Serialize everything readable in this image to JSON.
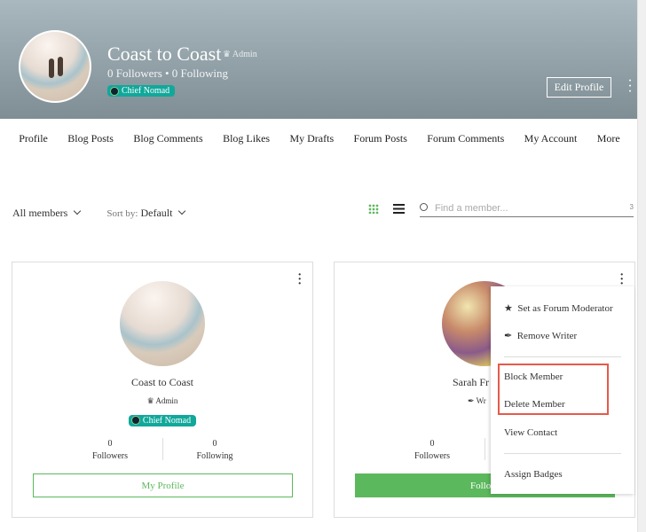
{
  "profile": {
    "name": "Coast to Coast",
    "role": "Admin",
    "stats": "0 Followers • 0 Following",
    "badge": "Chief Nomad",
    "edit_label": "Edit Profile"
  },
  "nav": [
    "Profile",
    "Blog Posts",
    "Blog Comments",
    "Blog Likes",
    "My Drafts",
    "Forum Posts",
    "Forum Comments",
    "My Account",
    "More"
  ],
  "filters": {
    "members": "All members",
    "sort_label": "Sort by:",
    "sort_value": "Default"
  },
  "search": {
    "placeholder": "Find a member...",
    "count": "3"
  },
  "cards": [
    {
      "name": "Coast to Coast",
      "role": "Admin",
      "badge": "Chief Nomad",
      "followers": "0",
      "followers_label": "Followers",
      "following": "0",
      "following_label": "Following",
      "button": "My Profile"
    },
    {
      "name": "Sarah Fr",
      "role": "Wr",
      "followers": "0",
      "followers_label": "Followers",
      "button": "Follo"
    }
  ],
  "menu": {
    "items": [
      "Set as Forum Moderator",
      "Remove Writer",
      "Block Member",
      "Delete Member",
      "View Contact",
      "Assign Badges"
    ]
  },
  "colors": {
    "accent": "#5cb85c",
    "badge": "#11a89b",
    "highlight": "#e55a4a"
  }
}
